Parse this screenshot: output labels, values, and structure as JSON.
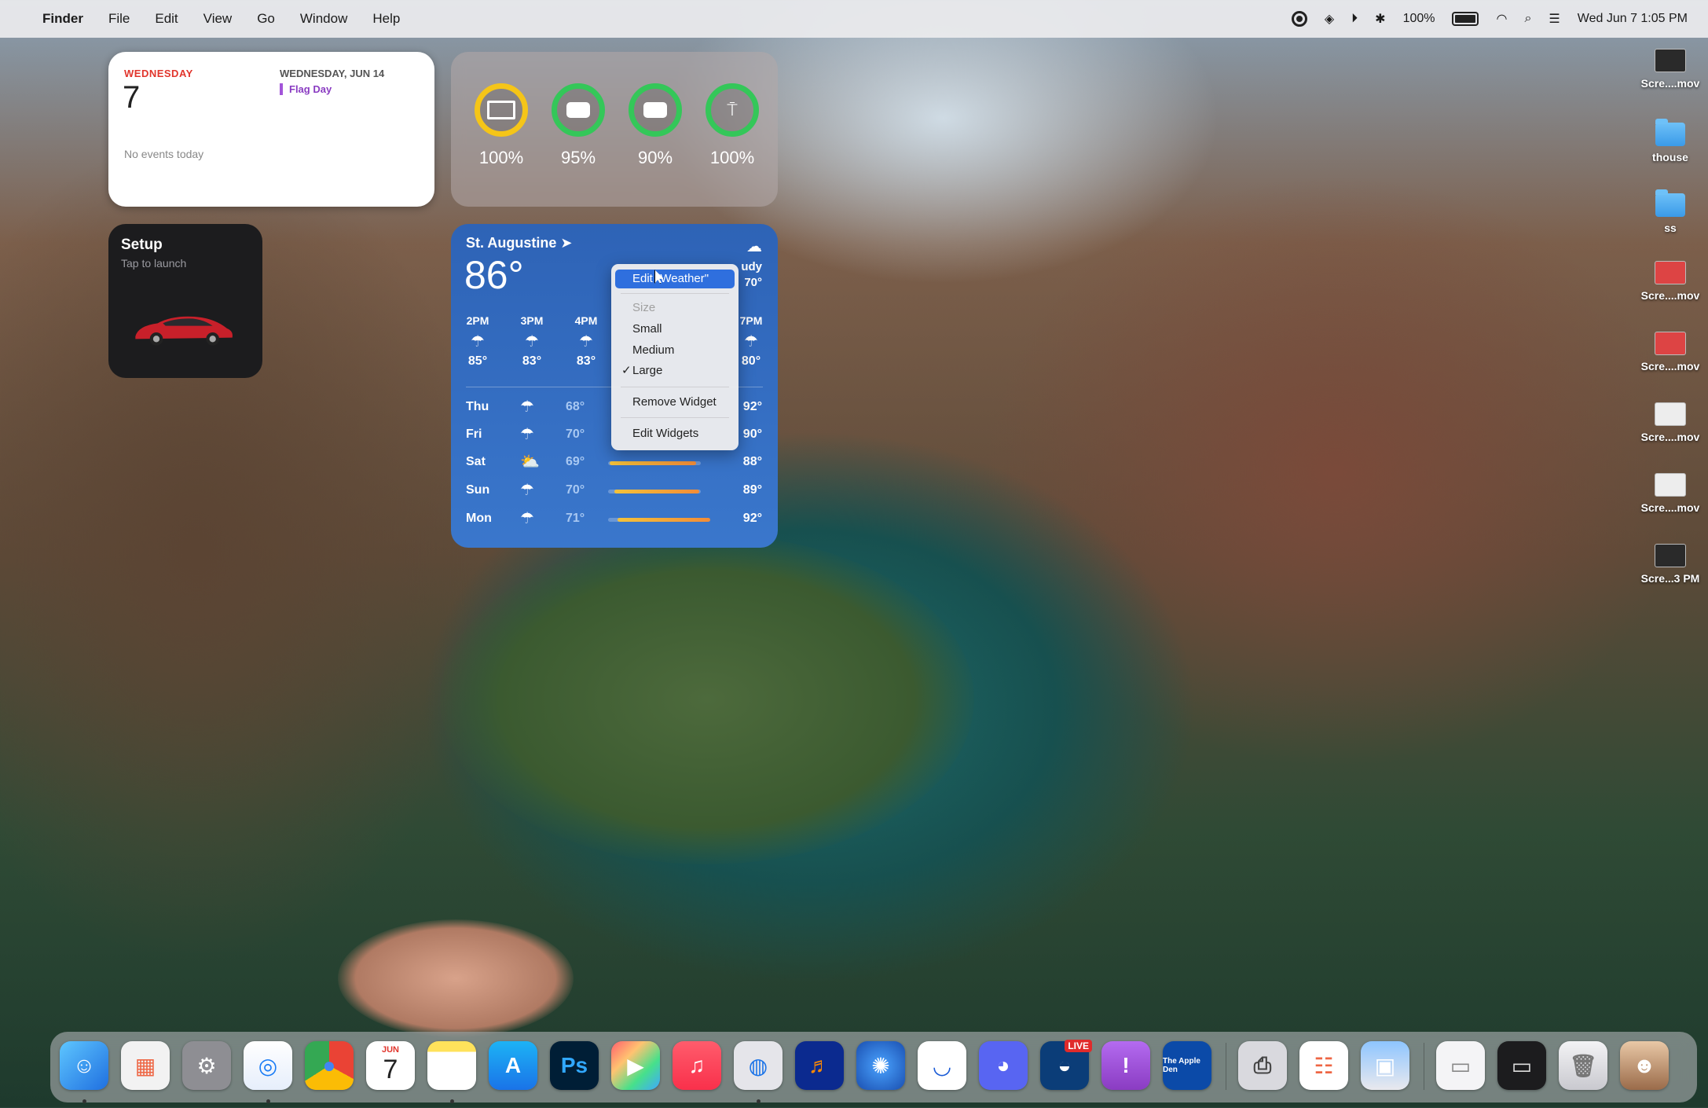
{
  "menubar": {
    "app_name": "Finder",
    "menus": [
      "File",
      "Edit",
      "View",
      "Go",
      "Window",
      "Help"
    ],
    "battery_pct": "100%",
    "datetime": "Wed Jun 7  1:05 PM"
  },
  "calendar_widget": {
    "weekday": "WEDNESDAY",
    "day_number": "7",
    "no_events": "No events today",
    "next_date": "WEDNESDAY, JUN 14",
    "next_event": "Flag Day"
  },
  "battery_widget": {
    "devices": [
      {
        "icon": "laptop-icon",
        "percent": "100%",
        "color": "#f5c518",
        "level": 1.0
      },
      {
        "icon": "airpods-case-icon",
        "percent": "95%",
        "color": "#34c759",
        "level": 0.95
      },
      {
        "icon": "airpods-case-icon",
        "percent": "90%",
        "color": "#34c759",
        "level": 0.9
      },
      {
        "icon": "airpods-icon",
        "percent": "100%",
        "color": "#34c759",
        "level": 1.0
      }
    ]
  },
  "setup_widget": {
    "title": "Setup",
    "subtitle": "Tap to launch"
  },
  "weather_widget": {
    "city": "St. Augustine",
    "temp": "86°",
    "condition": "udy",
    "hl": "70°",
    "hourly": [
      {
        "time": "2PM",
        "temp": "85°"
      },
      {
        "time": "3PM",
        "temp": "83°"
      },
      {
        "time": "4PM",
        "temp": "83°"
      },
      {
        "time": "7PM",
        "temp": "80°"
      }
    ],
    "daily": [
      {
        "day": "Thu",
        "low": "68°",
        "high": "92°",
        "icon": "rain-cloud-icon"
      },
      {
        "day": "Fri",
        "low": "70°",
        "high": "90°",
        "icon": "rain-cloud-icon"
      },
      {
        "day": "Sat",
        "low": "69°",
        "high": "88°",
        "icon": "sun-cloud-icon"
      },
      {
        "day": "Sun",
        "low": "70°",
        "high": "89°",
        "icon": "rain-cloud-icon"
      },
      {
        "day": "Mon",
        "low": "71°",
        "high": "92°",
        "icon": "rain-cloud-icon"
      }
    ]
  },
  "context_menu": {
    "edit_weather": "Edit \"Weather\"",
    "size_header": "Size",
    "small": "Small",
    "medium": "Medium",
    "large": "Large",
    "check": "✓",
    "remove": "Remove Widget",
    "edit_widgets": "Edit Widgets"
  },
  "desktop_icons": [
    {
      "label": "Scre....mov",
      "kind": "dark"
    },
    {
      "label": "thouse",
      "kind": "folder"
    },
    {
      "label": "ss",
      "kind": "folder"
    },
    {
      "label": "Scre....mov",
      "kind": "red"
    },
    {
      "label": "Scre....mov",
      "kind": "red"
    },
    {
      "label": "Scre....mov",
      "kind": "light"
    },
    {
      "label": "Scre....mov",
      "kind": "light"
    },
    {
      "label": "Scre...3 PM",
      "kind": "light"
    }
  ],
  "dock": {
    "calendar_month": "JUN",
    "calendar_day": "7",
    "ps_label": "Ps",
    "live_badge": "LIVE",
    "apple_den_label": "The Apple Den"
  }
}
